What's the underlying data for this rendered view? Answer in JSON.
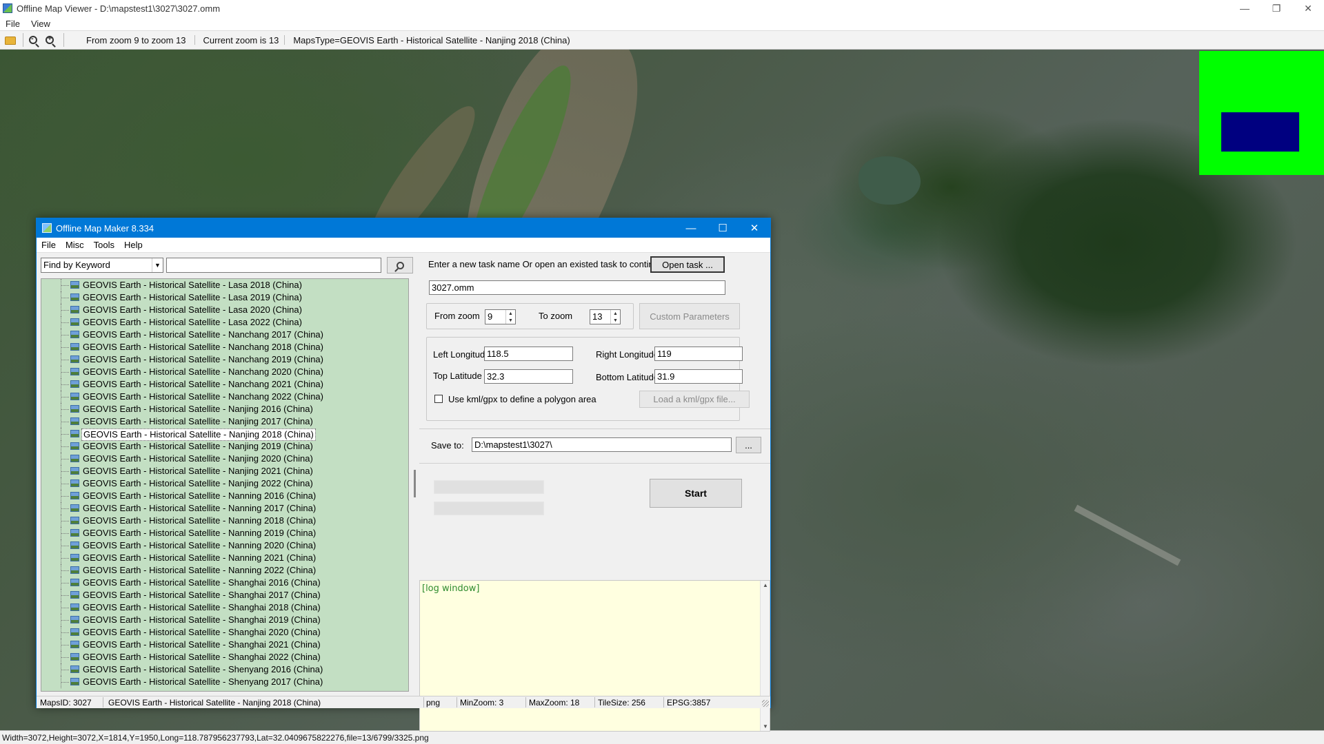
{
  "viewer": {
    "title": "Offline Map Viewer - D:\\mapstest1\\3027\\3027.omm",
    "menu": [
      "File",
      "View"
    ],
    "toolbar": {
      "zoom_range": "From zoom 9 to zoom 13",
      "current_zoom": "Current zoom is 13",
      "maps_type": "MapsType=GEOVIS Earth - Historical Satellite - Nanjing 2018 (China)"
    },
    "status": "Width=3072,Height=3072,X=1814,Y=1950,Long=118.787956237793,Lat=32.0409675822276,file=13/6799/3325.png"
  },
  "dialog": {
    "title": "Offline Map Maker 8.334",
    "menu": [
      "File",
      "Misc",
      "Tools",
      "Help"
    ],
    "find": {
      "mode": "Find by Keyword",
      "keyword": ""
    },
    "map_list": [
      "GEOVIS Earth - Historical Satellite - Lasa 2018 (China)",
      "GEOVIS Earth - Historical Satellite - Lasa 2019 (China)",
      "GEOVIS Earth - Historical Satellite - Lasa 2020 (China)",
      "GEOVIS Earth - Historical Satellite - Lasa 2022 (China)",
      "GEOVIS Earth - Historical Satellite - Nanchang 2017 (China)",
      "GEOVIS Earth - Historical Satellite - Nanchang 2018 (China)",
      "GEOVIS Earth - Historical Satellite - Nanchang 2019 (China)",
      "GEOVIS Earth - Historical Satellite - Nanchang 2020 (China)",
      "GEOVIS Earth - Historical Satellite - Nanchang 2021 (China)",
      "GEOVIS Earth - Historical Satellite - Nanchang 2022 (China)",
      "GEOVIS Earth - Historical Satellite - Nanjing 2016 (China)",
      "GEOVIS Earth - Historical Satellite - Nanjing 2017 (China)",
      "GEOVIS Earth - Historical Satellite - Nanjing 2018 (China)",
      "GEOVIS Earth - Historical Satellite - Nanjing 2019 (China)",
      "GEOVIS Earth - Historical Satellite - Nanjing 2020 (China)",
      "GEOVIS Earth - Historical Satellite - Nanjing 2021 (China)",
      "GEOVIS Earth - Historical Satellite - Nanjing 2022 (China)",
      "GEOVIS Earth - Historical Satellite - Nanning 2016 (China)",
      "GEOVIS Earth - Historical Satellite - Nanning 2017 (China)",
      "GEOVIS Earth - Historical Satellite - Nanning 2018 (China)",
      "GEOVIS Earth - Historical Satellite - Nanning 2019 (China)",
      "GEOVIS Earth - Historical Satellite - Nanning 2020 (China)",
      "GEOVIS Earth - Historical Satellite - Nanning 2021 (China)",
      "GEOVIS Earth - Historical Satellite - Nanning 2022 (China)",
      "GEOVIS Earth - Historical Satellite - Shanghai 2016 (China)",
      "GEOVIS Earth - Historical Satellite - Shanghai 2017 (China)",
      "GEOVIS Earth - Historical Satellite - Shanghai 2018 (China)",
      "GEOVIS Earth - Historical Satellite - Shanghai 2019 (China)",
      "GEOVIS Earth - Historical Satellite - Shanghai 2020 (China)",
      "GEOVIS Earth - Historical Satellite - Shanghai 2021 (China)",
      "GEOVIS Earth - Historical Satellite - Shanghai 2022 (China)",
      "GEOVIS Earth - Historical Satellite - Shenyang 2016 (China)",
      "GEOVIS Earth - Historical Satellite - Shenyang 2017 (China)"
    ],
    "selected_map": "GEOVIS Earth - Historical Satellite - Nanjing 2018 (China)",
    "task": {
      "prompt": "Enter a new task name Or open an existed task to continue:",
      "open_button": "Open task ...",
      "name": "3027.omm"
    },
    "zoom": {
      "from_label": "From zoom",
      "from_value": "9",
      "to_label": "To zoom",
      "to_value": "13",
      "custom_button": "Custom Parameters"
    },
    "bounds": {
      "left_label": "Left Longitude",
      "left_value": "118.5",
      "right_label": "Right Longitude",
      "right_value": "119",
      "top_label": "Top Latitude",
      "top_value": "32.3",
      "bottom_label": "Bottom Latitude",
      "bottom_value": "31.9",
      "kml_label": "Use kml/gpx to define a polygon area",
      "kml_button": "Load a kml/gpx file..."
    },
    "save": {
      "label": "Save to:",
      "path": "D:\\mapstest1\\3027\\",
      "browse_button": "..."
    },
    "start_button": "Start",
    "log_text": "[log window]",
    "status": {
      "maps_id": "MapsID: 3027",
      "map_name": "GEOVIS Earth - Historical Satellite - Nanjing 2018 (China)",
      "format": "png",
      "min_zoom": "MinZoom: 3",
      "max_zoom": "MaxZoom: 18",
      "tile_size": "TileSize: 256",
      "epsg": "EPSG:3857"
    }
  },
  "colors": {
    "minimap_bg": "#00ff00",
    "minimap_view": "#000080",
    "list_bg": "#c3dfc3",
    "log_bg": "#ffffe0",
    "accent": "#0078d7"
  }
}
